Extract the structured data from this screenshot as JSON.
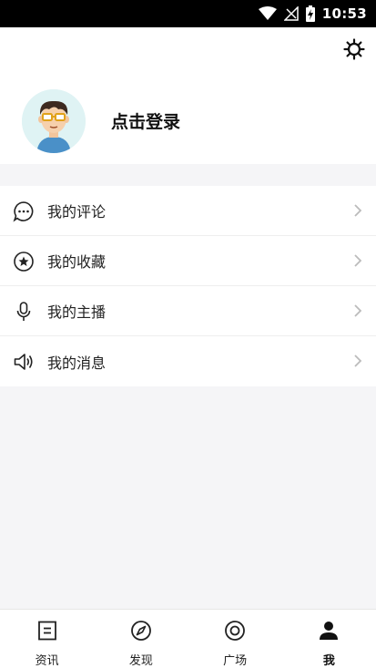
{
  "status_bar": {
    "time": "10:53"
  },
  "header": {
    "login_label": "点击登录"
  },
  "menu": {
    "items": [
      {
        "label": "我的评论",
        "icon": "comment-icon"
      },
      {
        "label": "我的收藏",
        "icon": "star-icon"
      },
      {
        "label": "我的主播",
        "icon": "microphone-icon"
      },
      {
        "label": "我的消息",
        "icon": "speaker-icon"
      }
    ]
  },
  "tabbar": {
    "active": "我",
    "tabs": [
      {
        "label": "资讯",
        "icon": "news-icon"
      },
      {
        "label": "发现",
        "icon": "compass-icon"
      },
      {
        "label": "广场",
        "icon": "plaza-icon"
      },
      {
        "label": "我",
        "icon": "user-icon"
      }
    ]
  },
  "colors": {
    "background": "#f5f5f7",
    "icon": "#222222",
    "chevron": "#bbbbbb"
  }
}
